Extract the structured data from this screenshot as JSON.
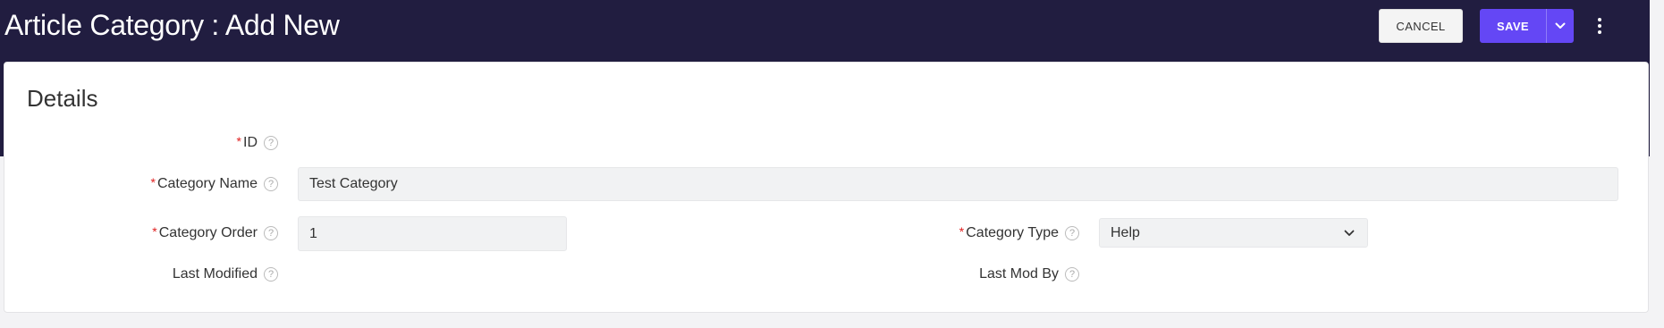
{
  "header": {
    "title": "Article Category : Add New",
    "cancel_label": "CANCEL",
    "save_label": "SAVE"
  },
  "section": {
    "title": "Details"
  },
  "form": {
    "id_label": "ID",
    "category_name_label": "Category Name",
    "category_name_value": "Test Category",
    "category_order_label": "Category Order",
    "category_order_value": "1",
    "category_type_label": "Category Type",
    "category_type_value": "Help",
    "last_modified_label": "Last Modified",
    "last_mod_by_label": "Last Mod By",
    "required_marker": "*",
    "help_glyph": "?"
  },
  "colors": {
    "header_bg": "#211d40",
    "primary": "#6447f5",
    "required": "#e02020"
  },
  "icons": {
    "help": "question-circle-icon",
    "dropdown": "chevron-down-icon",
    "more": "more-vertical-icon"
  }
}
